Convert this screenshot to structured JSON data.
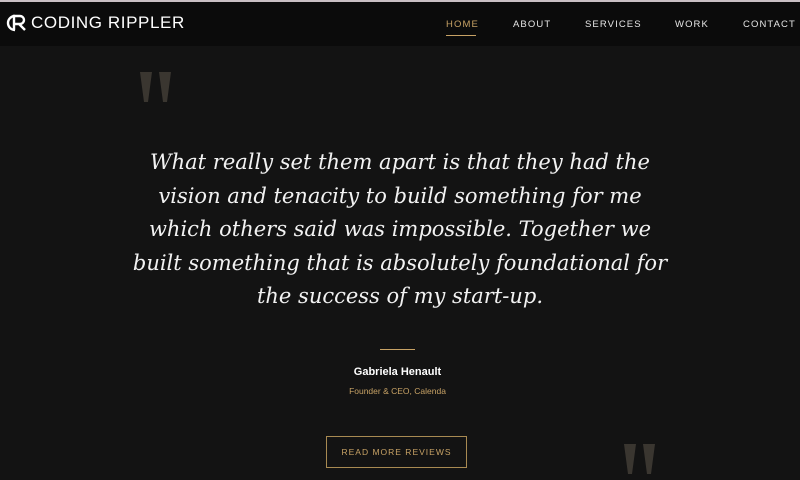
{
  "brand": {
    "logo_text": "CODING RIPPLER",
    "logo_icon": "cr-monogram-logo"
  },
  "nav": {
    "items": [
      {
        "label": "HOME",
        "active": true
      },
      {
        "label": "ABOUT",
        "active": false
      },
      {
        "label": "SERVICES",
        "active": false
      },
      {
        "label": "WORK",
        "active": false
      },
      {
        "label": "CONTACT",
        "active": false
      }
    ]
  },
  "testimonial": {
    "quote": "What really set them apart is that they had the vision and tenacity to build something for me which others said was impossible. Together we built something that is absolutely foundational for the success of my start-up.",
    "author_name": "Gabriela Henault",
    "author_title": "Founder & CEO, Calenda",
    "cta_label": "READ MORE REVIEWS",
    "open_quote_icon": "open-quote-icon",
    "close_quote_icon": "close-quote-icon"
  },
  "colors": {
    "background": "#131313",
    "navbar": "#0b0b0b",
    "accent_gold": "#c7a265",
    "quote_mark": "#3a3630",
    "text": "#f2f2f2"
  }
}
